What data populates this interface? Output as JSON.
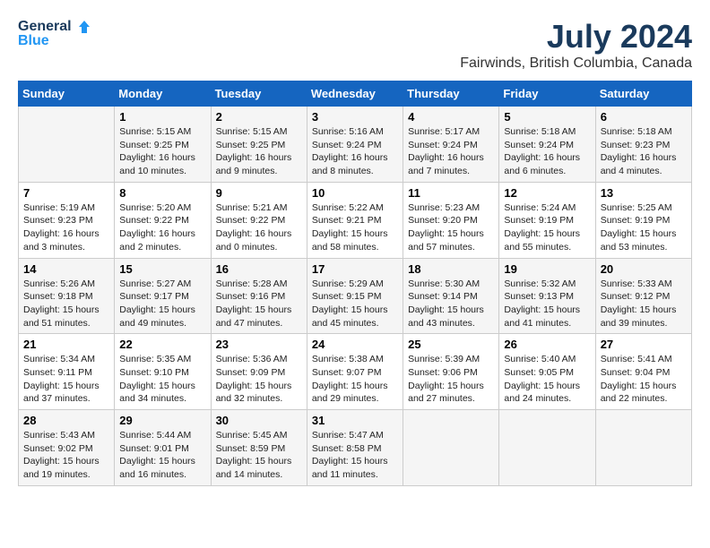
{
  "header": {
    "logo_line1": "General",
    "logo_line2": "Blue",
    "title": "July 2024",
    "subtitle": "Fairwinds, British Columbia, Canada"
  },
  "days_of_week": [
    "Sunday",
    "Monday",
    "Tuesday",
    "Wednesday",
    "Thursday",
    "Friday",
    "Saturday"
  ],
  "weeks": [
    [
      {
        "day": "",
        "info": ""
      },
      {
        "day": "1",
        "info": "Sunrise: 5:15 AM\nSunset: 9:25 PM\nDaylight: 16 hours\nand 10 minutes."
      },
      {
        "day": "2",
        "info": "Sunrise: 5:15 AM\nSunset: 9:25 PM\nDaylight: 16 hours\nand 9 minutes."
      },
      {
        "day": "3",
        "info": "Sunrise: 5:16 AM\nSunset: 9:24 PM\nDaylight: 16 hours\nand 8 minutes."
      },
      {
        "day": "4",
        "info": "Sunrise: 5:17 AM\nSunset: 9:24 PM\nDaylight: 16 hours\nand 7 minutes."
      },
      {
        "day": "5",
        "info": "Sunrise: 5:18 AM\nSunset: 9:24 PM\nDaylight: 16 hours\nand 6 minutes."
      },
      {
        "day": "6",
        "info": "Sunrise: 5:18 AM\nSunset: 9:23 PM\nDaylight: 16 hours\nand 4 minutes."
      }
    ],
    [
      {
        "day": "7",
        "info": "Sunrise: 5:19 AM\nSunset: 9:23 PM\nDaylight: 16 hours\nand 3 minutes."
      },
      {
        "day": "8",
        "info": "Sunrise: 5:20 AM\nSunset: 9:22 PM\nDaylight: 16 hours\nand 2 minutes."
      },
      {
        "day": "9",
        "info": "Sunrise: 5:21 AM\nSunset: 9:22 PM\nDaylight: 16 hours\nand 0 minutes."
      },
      {
        "day": "10",
        "info": "Sunrise: 5:22 AM\nSunset: 9:21 PM\nDaylight: 15 hours\nand 58 minutes."
      },
      {
        "day": "11",
        "info": "Sunrise: 5:23 AM\nSunset: 9:20 PM\nDaylight: 15 hours\nand 57 minutes."
      },
      {
        "day": "12",
        "info": "Sunrise: 5:24 AM\nSunset: 9:19 PM\nDaylight: 15 hours\nand 55 minutes."
      },
      {
        "day": "13",
        "info": "Sunrise: 5:25 AM\nSunset: 9:19 PM\nDaylight: 15 hours\nand 53 minutes."
      }
    ],
    [
      {
        "day": "14",
        "info": "Sunrise: 5:26 AM\nSunset: 9:18 PM\nDaylight: 15 hours\nand 51 minutes."
      },
      {
        "day": "15",
        "info": "Sunrise: 5:27 AM\nSunset: 9:17 PM\nDaylight: 15 hours\nand 49 minutes."
      },
      {
        "day": "16",
        "info": "Sunrise: 5:28 AM\nSunset: 9:16 PM\nDaylight: 15 hours\nand 47 minutes."
      },
      {
        "day": "17",
        "info": "Sunrise: 5:29 AM\nSunset: 9:15 PM\nDaylight: 15 hours\nand 45 minutes."
      },
      {
        "day": "18",
        "info": "Sunrise: 5:30 AM\nSunset: 9:14 PM\nDaylight: 15 hours\nand 43 minutes."
      },
      {
        "day": "19",
        "info": "Sunrise: 5:32 AM\nSunset: 9:13 PM\nDaylight: 15 hours\nand 41 minutes."
      },
      {
        "day": "20",
        "info": "Sunrise: 5:33 AM\nSunset: 9:12 PM\nDaylight: 15 hours\nand 39 minutes."
      }
    ],
    [
      {
        "day": "21",
        "info": "Sunrise: 5:34 AM\nSunset: 9:11 PM\nDaylight: 15 hours\nand 37 minutes."
      },
      {
        "day": "22",
        "info": "Sunrise: 5:35 AM\nSunset: 9:10 PM\nDaylight: 15 hours\nand 34 minutes."
      },
      {
        "day": "23",
        "info": "Sunrise: 5:36 AM\nSunset: 9:09 PM\nDaylight: 15 hours\nand 32 minutes."
      },
      {
        "day": "24",
        "info": "Sunrise: 5:38 AM\nSunset: 9:07 PM\nDaylight: 15 hours\nand 29 minutes."
      },
      {
        "day": "25",
        "info": "Sunrise: 5:39 AM\nSunset: 9:06 PM\nDaylight: 15 hours\nand 27 minutes."
      },
      {
        "day": "26",
        "info": "Sunrise: 5:40 AM\nSunset: 9:05 PM\nDaylight: 15 hours\nand 24 minutes."
      },
      {
        "day": "27",
        "info": "Sunrise: 5:41 AM\nSunset: 9:04 PM\nDaylight: 15 hours\nand 22 minutes."
      }
    ],
    [
      {
        "day": "28",
        "info": "Sunrise: 5:43 AM\nSunset: 9:02 PM\nDaylight: 15 hours\nand 19 minutes."
      },
      {
        "day": "29",
        "info": "Sunrise: 5:44 AM\nSunset: 9:01 PM\nDaylight: 15 hours\nand 16 minutes."
      },
      {
        "day": "30",
        "info": "Sunrise: 5:45 AM\nSunset: 8:59 PM\nDaylight: 15 hours\nand 14 minutes."
      },
      {
        "day": "31",
        "info": "Sunrise: 5:47 AM\nSunset: 8:58 PM\nDaylight: 15 hours\nand 11 minutes."
      },
      {
        "day": "",
        "info": ""
      },
      {
        "day": "",
        "info": ""
      },
      {
        "day": "",
        "info": ""
      }
    ]
  ]
}
